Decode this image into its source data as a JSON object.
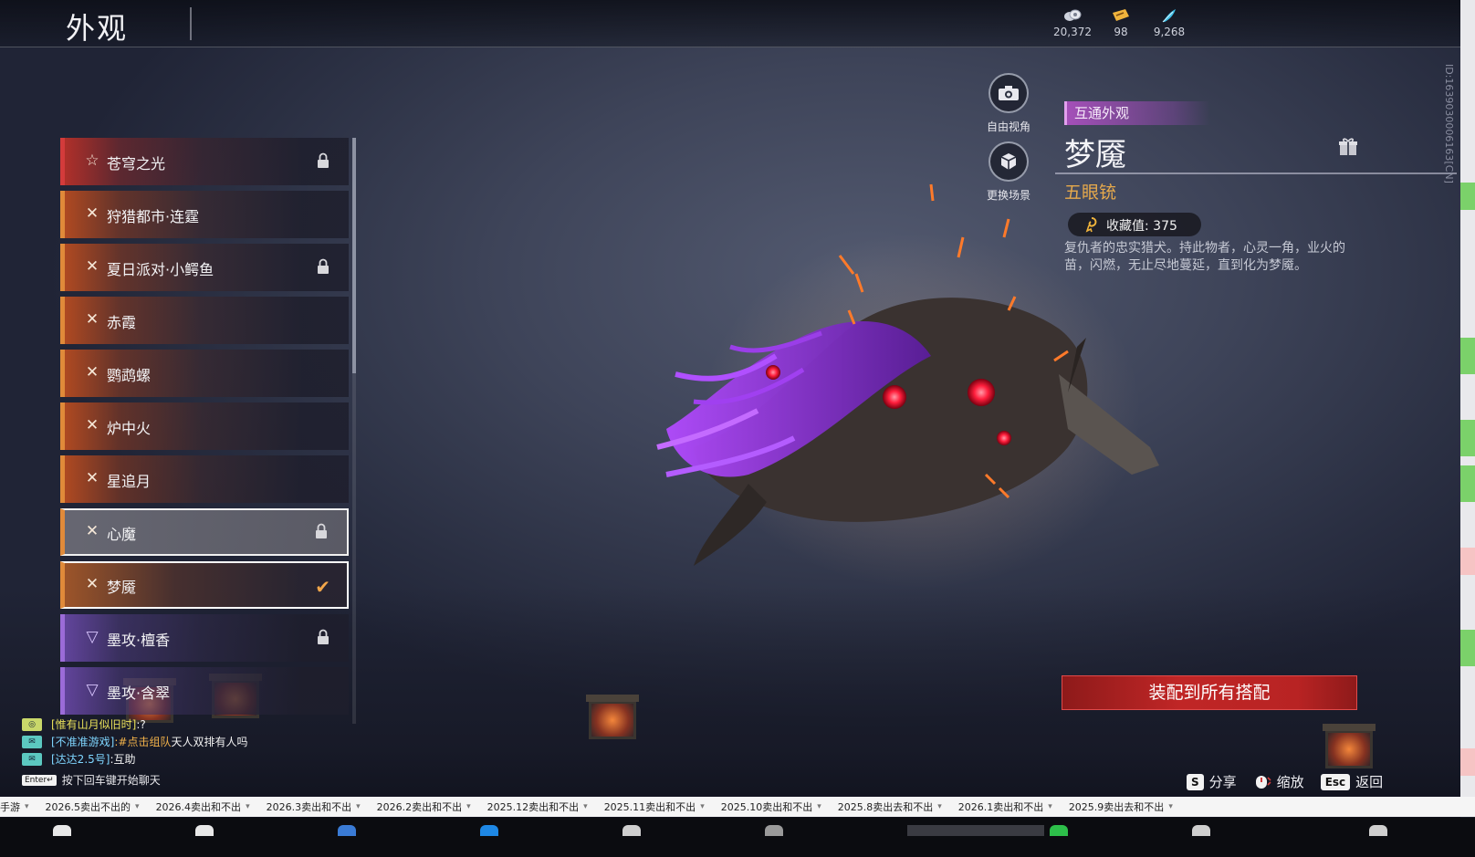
{
  "header": {
    "title": "外观"
  },
  "currencies": [
    {
      "icon": "coin-stack-icon",
      "value": "20,372"
    },
    {
      "icon": "ticket-icon",
      "value": "98"
    },
    {
      "icon": "feather-icon",
      "value": "9,268"
    }
  ],
  "player_id": "ID:1639030006163[CN]",
  "skins": [
    {
      "name": "苍穹之光",
      "rarity": "red",
      "locked": true,
      "equipped": false
    },
    {
      "name": "狩猎都市·连霆",
      "rarity": "orange",
      "locked": false,
      "equipped": false
    },
    {
      "name": "夏日派对·小鳄鱼",
      "rarity": "orange",
      "locked": true,
      "equipped": false
    },
    {
      "name": "赤霞",
      "rarity": "orange",
      "locked": false,
      "equipped": false
    },
    {
      "name": "鹦鹉螺",
      "rarity": "orange",
      "locked": false,
      "equipped": false
    },
    {
      "name": "炉中火",
      "rarity": "orange",
      "locked": false,
      "equipped": false
    },
    {
      "name": "星追月",
      "rarity": "orange",
      "locked": false,
      "equipped": false
    },
    {
      "name": "心魔",
      "rarity": "orange",
      "locked": true,
      "equipped": false
    },
    {
      "name": "梦魇",
      "rarity": "orange",
      "locked": false,
      "equipped": true
    },
    {
      "name": "墨攻·檀香",
      "rarity": "purple",
      "locked": true,
      "equipped": false
    },
    {
      "name": "墨攻·含翠",
      "rarity": "purple",
      "locked": false,
      "equipped": false
    }
  ],
  "camera": {
    "free_view": "自由视角",
    "change_scene": "更换场景"
  },
  "detail": {
    "tag": "互通外观",
    "name": "梦魇",
    "weapon_type": "五眼铳",
    "collect_label": "收藏值: 375",
    "description": "复仇者的忠实猎犬。持此物者，心灵一角，业火的苗，闪燃，无止尽地蔓延，直到化为梦魇。"
  },
  "equip_button": "装配到所有搭配",
  "hotkeys": [
    {
      "key": "S",
      "label": "分享"
    },
    {
      "key": "",
      "label": "缩放"
    },
    {
      "key": "Esc",
      "label": "返回"
    }
  ],
  "chat": {
    "lines": [
      {
        "name": "[惟有山月似旧时]",
        "hash": "",
        "msg": ":?"
      },
      {
        "name": "[不准准游戏]",
        "hash": ":#点击组队",
        "msg": " 天人双排有人吗"
      },
      {
        "name": "[达达2.5号]",
        "hash": "",
        "msg": ":互助"
      }
    ],
    "enter_key": "Enter↵",
    "hint": "按下回车键开始聊天"
  },
  "bookmarks": [
    "手游",
    "2026.5卖出不出的",
    "2026.4卖出和不出",
    "2026.3卖出和不出",
    "2026.2卖出和不出",
    "2025.12卖出和不出",
    "2025.11卖出和不出",
    "2025.10卖出和不出",
    "2025.8卖出去和不出",
    "2026.1卖出和不出",
    "2025.9卖出去和不出"
  ],
  "colors": {
    "orange_rarity": "#e08a3a",
    "red_rarity": "#d33b3b",
    "purple_rarity": "#9b6bd8",
    "equip_red": "#c02626",
    "weapon_type": "#e6a94c"
  }
}
